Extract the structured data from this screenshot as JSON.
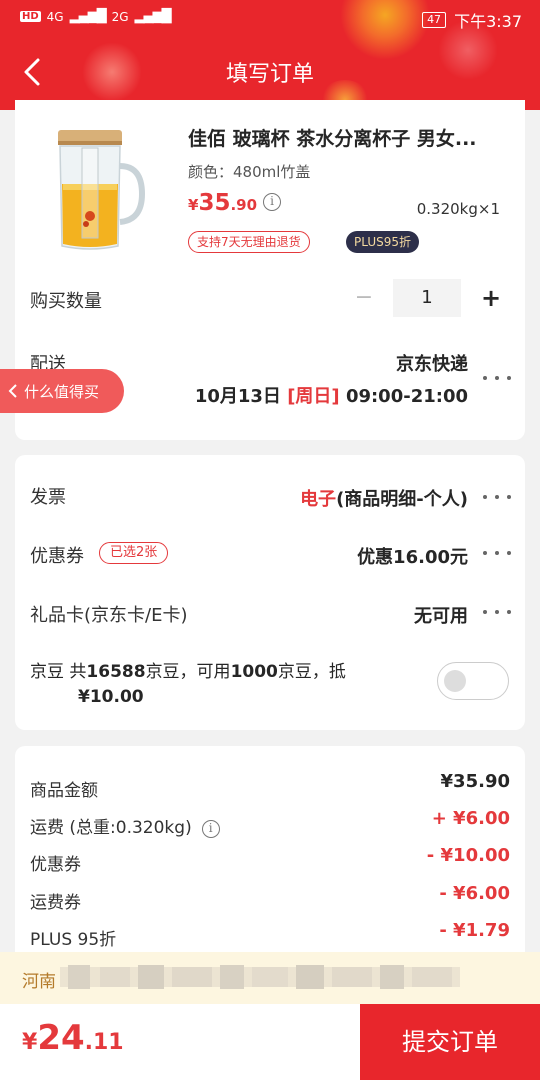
{
  "status_bar": {
    "hd": "HD",
    "net1": "4G",
    "net2": "2G",
    "battery": "47",
    "time": "下午3:37"
  },
  "nav": {
    "title": "填写订单",
    "back_icon": "chevron-left-icon"
  },
  "product": {
    "title": "佳佰 玻璃杯 茶水分离杯子 男女...",
    "spec": "颜色：480ml竹盖",
    "price_currency": "¥",
    "price_int": "35",
    "price_dec": ".90",
    "weight": "0.320kg×1",
    "tag_refund": "支持7天无理由退货",
    "tag_plus": "PLUS95折"
  },
  "quantity": {
    "label": "购买数量",
    "minus": "−",
    "value": "1",
    "plus": "+"
  },
  "delivery": {
    "label": "配送",
    "carrier": "京东快递",
    "date": "10月13日",
    "weekday": "[周日]",
    "time": "09:00-21:00"
  },
  "worth_button": "什么值得买",
  "invoice": {
    "label": "发票",
    "type": "电子",
    "detail": "(商品明细-个人)"
  },
  "coupon": {
    "label": "优惠券",
    "tag": "已选2张",
    "value": "优惠16.00元"
  },
  "gift_card": {
    "label": "礼品卡(京东卡/E卡)",
    "value": "无可用"
  },
  "jingdou": {
    "prefix": "京豆 共",
    "total": "16588",
    "mid1": "京豆，可用",
    "usable": "1000",
    "mid2": "京豆，抵",
    "amount": "¥10.00",
    "enabled": false
  },
  "summary": [
    {
      "label": "商品金额",
      "value": "¥35.90",
      "info": false
    },
    {
      "label": "运费 (总重:0.320kg)",
      "value": "+ ¥6.00",
      "info": true
    },
    {
      "label": "优惠券",
      "value": "- ¥10.00",
      "info": false
    },
    {
      "label": "运费券",
      "value": "- ¥6.00",
      "info": false
    },
    {
      "label": "PLUS 95折",
      "value": "- ¥1.79",
      "info": false
    }
  ],
  "address": {
    "label": "河南"
  },
  "total": {
    "currency": "¥",
    "int": "24",
    "dec": ".11"
  },
  "submit_label": "提交订单",
  "colors": {
    "brand_red": "#e8262c",
    "price_red": "#e4393c",
    "plus_dark": "#2d2f4a"
  }
}
